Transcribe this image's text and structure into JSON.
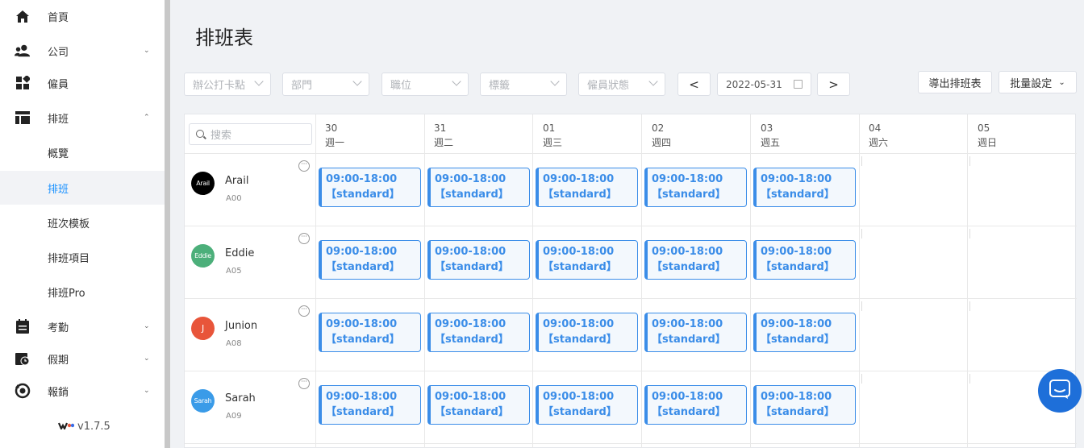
{
  "sidebar": {
    "items": [
      {
        "label": "首頁",
        "icon": "home-icon",
        "chevron": ""
      },
      {
        "label": "公司",
        "icon": "users-icon",
        "chevron": "⌄"
      },
      {
        "label": "僱員",
        "icon": "grid-icon",
        "chevron": ""
      },
      {
        "label": "排班",
        "icon": "table-icon",
        "chevron": "⌃"
      },
      {
        "label": "概覽",
        "sub": true
      },
      {
        "label": "排班",
        "sub": true,
        "active": true
      },
      {
        "label": "班次模板",
        "sub": true
      },
      {
        "label": "排班項目",
        "sub": true
      },
      {
        "label": "排班Pro",
        "sub": true
      },
      {
        "label": "考勤",
        "icon": "calendar-icon",
        "chevron": "⌄"
      },
      {
        "label": "假期",
        "icon": "clock-calendar-icon",
        "chevron": "⌄"
      },
      {
        "label": "報銷",
        "icon": "refund-icon",
        "chevron": "⌄"
      }
    ],
    "version": "v1.7.5"
  },
  "page": {
    "title": "排班表"
  },
  "filters": [
    {
      "label": "辦公打卡點"
    },
    {
      "label": "部門"
    },
    {
      "label": "職位"
    },
    {
      "label": "標籤"
    },
    {
      "label": "僱員狀態"
    }
  ],
  "date_nav": {
    "prev": "<",
    "date": "2022-05-31",
    "next": ">"
  },
  "actions": {
    "export": "導出排班表",
    "batch": "批量設定"
  },
  "search": {
    "placeholder": "搜索"
  },
  "days": [
    {
      "num": "30",
      "weekday": "週一"
    },
    {
      "num": "31",
      "weekday": "週二"
    },
    {
      "num": "01",
      "weekday": "週三"
    },
    {
      "num": "02",
      "weekday": "週四"
    },
    {
      "num": "03",
      "weekday": "週五"
    },
    {
      "num": "04",
      "weekday": "週六"
    },
    {
      "num": "05",
      "weekday": "週日"
    }
  ],
  "employees": [
    {
      "name": "Arail",
      "code": "A00",
      "avatar": "Arail",
      "color": "#000000"
    },
    {
      "name": "Eddie",
      "code": "A05",
      "avatar": "Eddie",
      "color": "#4caf7a"
    },
    {
      "name": "Junion",
      "code": "A08",
      "avatar": "J",
      "color": "#e8553a"
    },
    {
      "name": "Sarah",
      "code": "A09",
      "avatar": "Sarah",
      "color": "#3a9be8"
    }
  ],
  "shift": {
    "time": "09:00-18:00",
    "type": "【standard】"
  },
  "colors": {
    "accent": "#1890ff",
    "shift": "#3b8de8",
    "chat": "#1e6fd9"
  }
}
